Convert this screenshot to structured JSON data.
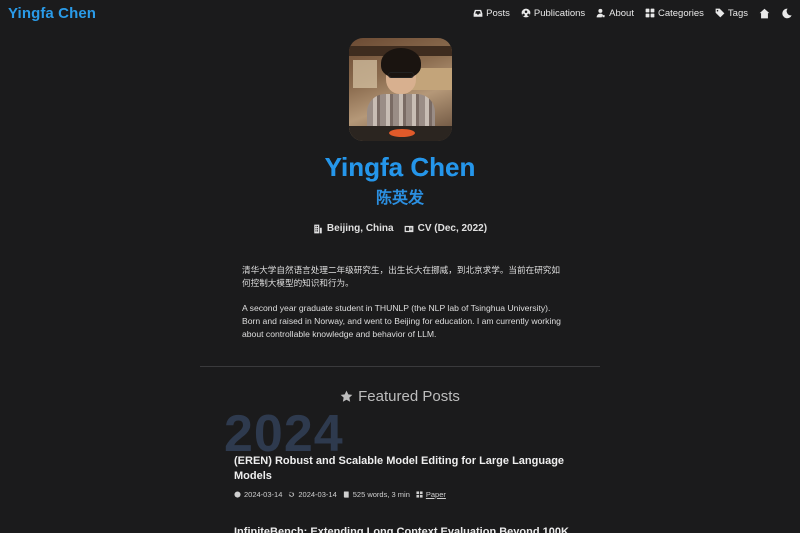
{
  "navbar": {
    "brand": "Yingfa Chen",
    "items": [
      {
        "label": "Posts",
        "icon": "archive-icon"
      },
      {
        "label": "Publications",
        "icon": "rocket-icon"
      },
      {
        "label": "About",
        "icon": "user-icon"
      },
      {
        "label": "Categories",
        "icon": "grid-icon"
      },
      {
        "label": "Tags",
        "icon": "tag-icon"
      }
    ],
    "extra_icons": [
      "home-icon",
      "moon-icon"
    ]
  },
  "profile": {
    "name": "Yingfa Chen",
    "name_cn": "陈英发",
    "location": "Beijing, China",
    "cv": "CV (Dec, 2022)"
  },
  "bio": {
    "cn": "清华大学自然语言处理二年级研究生，出生长大在挪威，到北京求学。当前在研究如何控制大模型的知识和行为。",
    "en": "A second year graduate student in THUNLP (the NLP lab of Tsinghua University). Born and raised in Norway, and went to Beijing for education. I am currently working about controllable knowledge and behavior of LLM."
  },
  "featured": {
    "title": "Featured Posts",
    "year": "2024",
    "posts": [
      {
        "title": "(EREN) Robust and Scalable Model Editing for Large Language Models",
        "published": "2024-03-14",
        "updated": "2024-03-14",
        "words": "525 words, 3 min",
        "category": "Paper"
      },
      {
        "title": "InfiniteBench: Extending Long Context Evaluation Beyond 100K"
      }
    ]
  },
  "colors": {
    "background": "#1b1b1c",
    "accent": "#2596ea",
    "year_watermark": "#2e3a4e"
  }
}
